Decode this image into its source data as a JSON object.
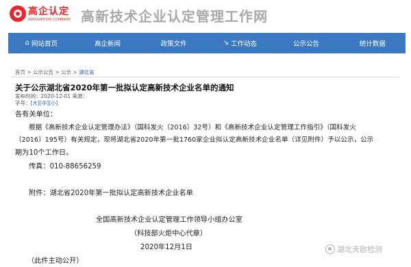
{
  "header": {
    "logo_text": "高企认定",
    "logo_subtext": "INNOVATION COMPANY",
    "site_title": "高新技术企业认定管理工作网"
  },
  "nav": {
    "items": [
      {
        "label": "网站首页",
        "icon": "home-icon",
        "glyph": "⌂"
      },
      {
        "label": "高企新闻",
        "icon": "",
        "glyph": ""
      },
      {
        "label": "政策文件",
        "icon": "",
        "glyph": ""
      },
      {
        "label": "工作动态",
        "icon": "arrow-icon",
        "glyph": "↘"
      },
      {
        "label": "公示公告",
        "icon": "",
        "glyph": ""
      },
      {
        "label": "统计数据",
        "icon": "",
        "glyph": ""
      }
    ]
  },
  "breadcrumb": {
    "items": [
      "首页",
      "公示公告",
      "公示"
    ],
    "separator": " > ",
    "current": "湖北省"
  },
  "article": {
    "title": "关于公示湖北省2020年第一批拟认定高新技术企业名单的通知",
    "publish_label": "发布时间：",
    "publish_date": "2020-12-01",
    "source_label": "来源：",
    "size_label": "字号：",
    "size_large": "[大]",
    "size_medium": "[中]",
    "size_small": "[小]",
    "salutation": "各有关单位：",
    "para_line1": "根据《高新技术企业认定管理办法》（国科发火〔2016〕32号）和《高新技术企业认定管理工作指引》（国科发火",
    "para_line2": "〔2016〕195号）有关规定，现将湖北省2020年第一批1760家企业拟认定高新技术企业名单（详见附件）予以公示，公示",
    "para_line3": "期为10个工作日。",
    "fax": "传真：010-88656259",
    "attachment": "附件：湖北省2020年第一批拟认定高新技术企业名单",
    "signature_org": "全国高新技术企业认定管理工作领导小组办公室",
    "signature_proxy": "（科技部火炬中心代章）",
    "signature_date": "2020年12月1日",
    "public_note": "（此件主动公开）"
  },
  "watermark": {
    "text": "湖北天欧检测"
  },
  "colors": {
    "nav_bg": "#3a78c2",
    "logo_red": "#e8262b",
    "link_blue": "#2a62b4",
    "title_gray": "#a9a9a9"
  }
}
